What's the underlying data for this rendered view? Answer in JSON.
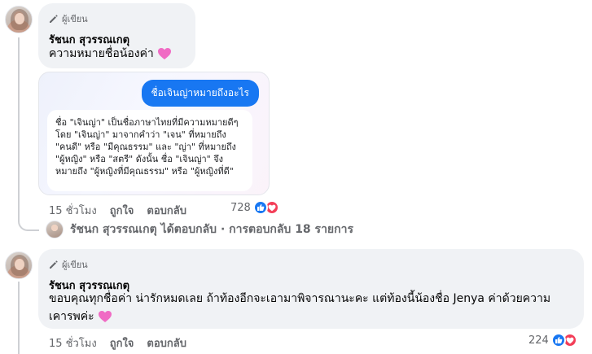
{
  "comments": [
    {
      "badge": "ผู้เขียน",
      "author": "รัชนก สุวรรณเกตุ",
      "text": "ความหมายชื่อน้องค่า",
      "time": "15 ชั่วโมง",
      "like_label": "ถูกใจ",
      "reply_label": "ตอบกลับ",
      "reaction_count": "728",
      "image": {
        "question": "ชื่อเจินญ่าหมายถึงอะไร",
        "answer": "ชื่อ \"เจินญ่า\" เป็นชื่อภาษาไทยที่มีความหมายดีๆ โดย \"เจินญ่า\" มาจากคำว่า \"เจน\" ที่หมายถึง \"คนดี\" หรือ \"มีคุณธรรม\" และ \"ญ่า\" ที่หมายถึง \"ผู้หญิง\" หรือ \"สตรี\" ดังนั้น ชื่อ \"เจินญ่า\" จึงหมายถึง \"ผู้หญิงที่มีคุณธรรม\" หรือ \"ผู้หญิงที่ดี\""
      }
    },
    {
      "badge": "ผู้เขียน",
      "author": "รัชนก สุวรรณเกตุ",
      "text": "ขอบคุณทุกชื่อค่า น่ารักหมดเลย ถ้าท้องอีกจะเอามาพิจารณานะคะ แต่ท้องนี้น้องชื่อ Jenya ค่าด้วยความเคารพค่ะ",
      "time": "15 ชั่วโมง",
      "like_label": "ถูกใจ",
      "reply_label": "ตอบกลับ",
      "reaction_count": "224"
    }
  ],
  "replies_summary": {
    "text": "รัชนก สุวรรณเกตุ ได้ตอบกลับ · การตอบกลับ 18 รายการ"
  },
  "colors": {
    "bubble": "#f0f2f5",
    "like": "#1877f2",
    "love": "#f33e58",
    "meta": "#65676b"
  }
}
